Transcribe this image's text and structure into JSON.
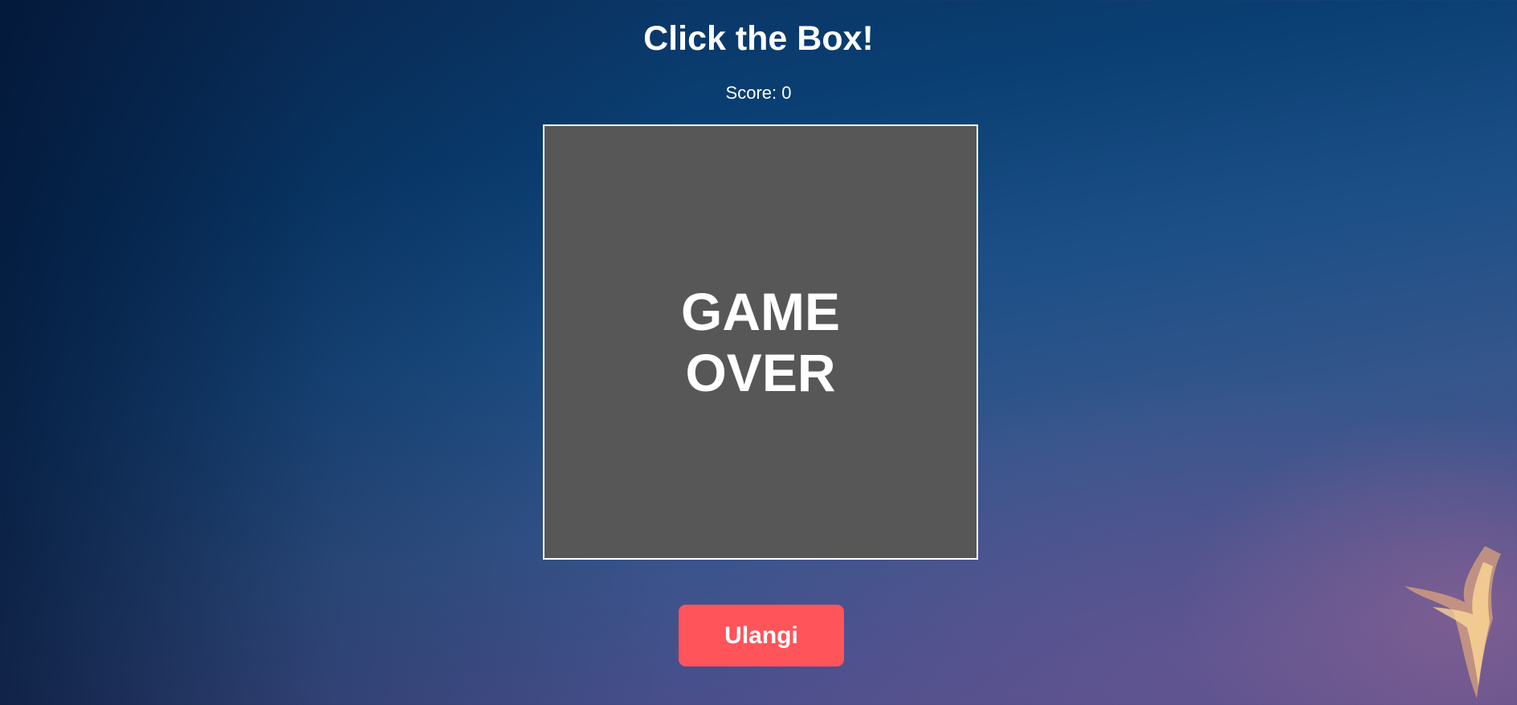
{
  "game": {
    "title": "Click the Box!",
    "score_text": "Score: 0",
    "box_message": "GAME OVER",
    "retry_label": "Ulangi"
  },
  "colors": {
    "box_background": "#575757",
    "button_background": "#ff5459",
    "text": "#ffffff"
  }
}
